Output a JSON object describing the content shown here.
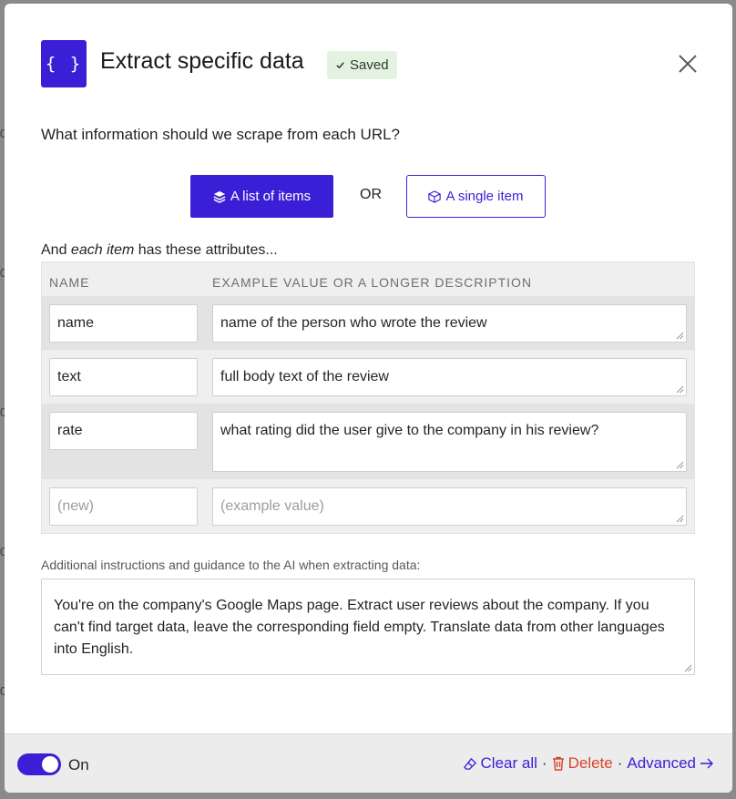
{
  "header": {
    "icon_glyph": "{ }",
    "title": "Extract specific data",
    "saved_badge": "Saved"
  },
  "question": "What information should we scrape from each URL?",
  "mode": {
    "list_label": "A list of items",
    "or_label": "OR",
    "single_label": "A single item",
    "selected": "list"
  },
  "attributes_label": {
    "prefix": "And ",
    "emphasis": "each item",
    "suffix": " has these attributes..."
  },
  "table": {
    "headers": [
      "NAME",
      "EXAMPLE VALUE OR A LONGER DESCRIPTION"
    ],
    "rows": [
      {
        "name": "name",
        "value": "name of the person who wrote the review"
      },
      {
        "name": "text",
        "value": "full body text of the review"
      },
      {
        "name": "rate",
        "value": "what rating did the user give to the company in his review?"
      }
    ],
    "new_row": {
      "name_placeholder": "(new)",
      "value_placeholder": "(example value)"
    }
  },
  "guidance": {
    "label": "Additional instructions and guidance to the AI when extracting data:",
    "text": "You're on the company's Google Maps page. Extract user reviews about the company. If you can't find target data, leave the corresponding field empty. Translate data from other languages into English."
  },
  "footer": {
    "toggle_label": "On",
    "toggle_on": true,
    "clear_label": "Clear all",
    "delete_label": "Delete",
    "advanced_label": "Advanced",
    "separator": "·"
  },
  "colors": {
    "accent": "#3b1fd6",
    "danger": "#d8432c",
    "saved_bg": "#e4f2e1"
  },
  "background_fragments": [
    "0",
    "0",
    "0",
    "0",
    "0",
    "0"
  ]
}
